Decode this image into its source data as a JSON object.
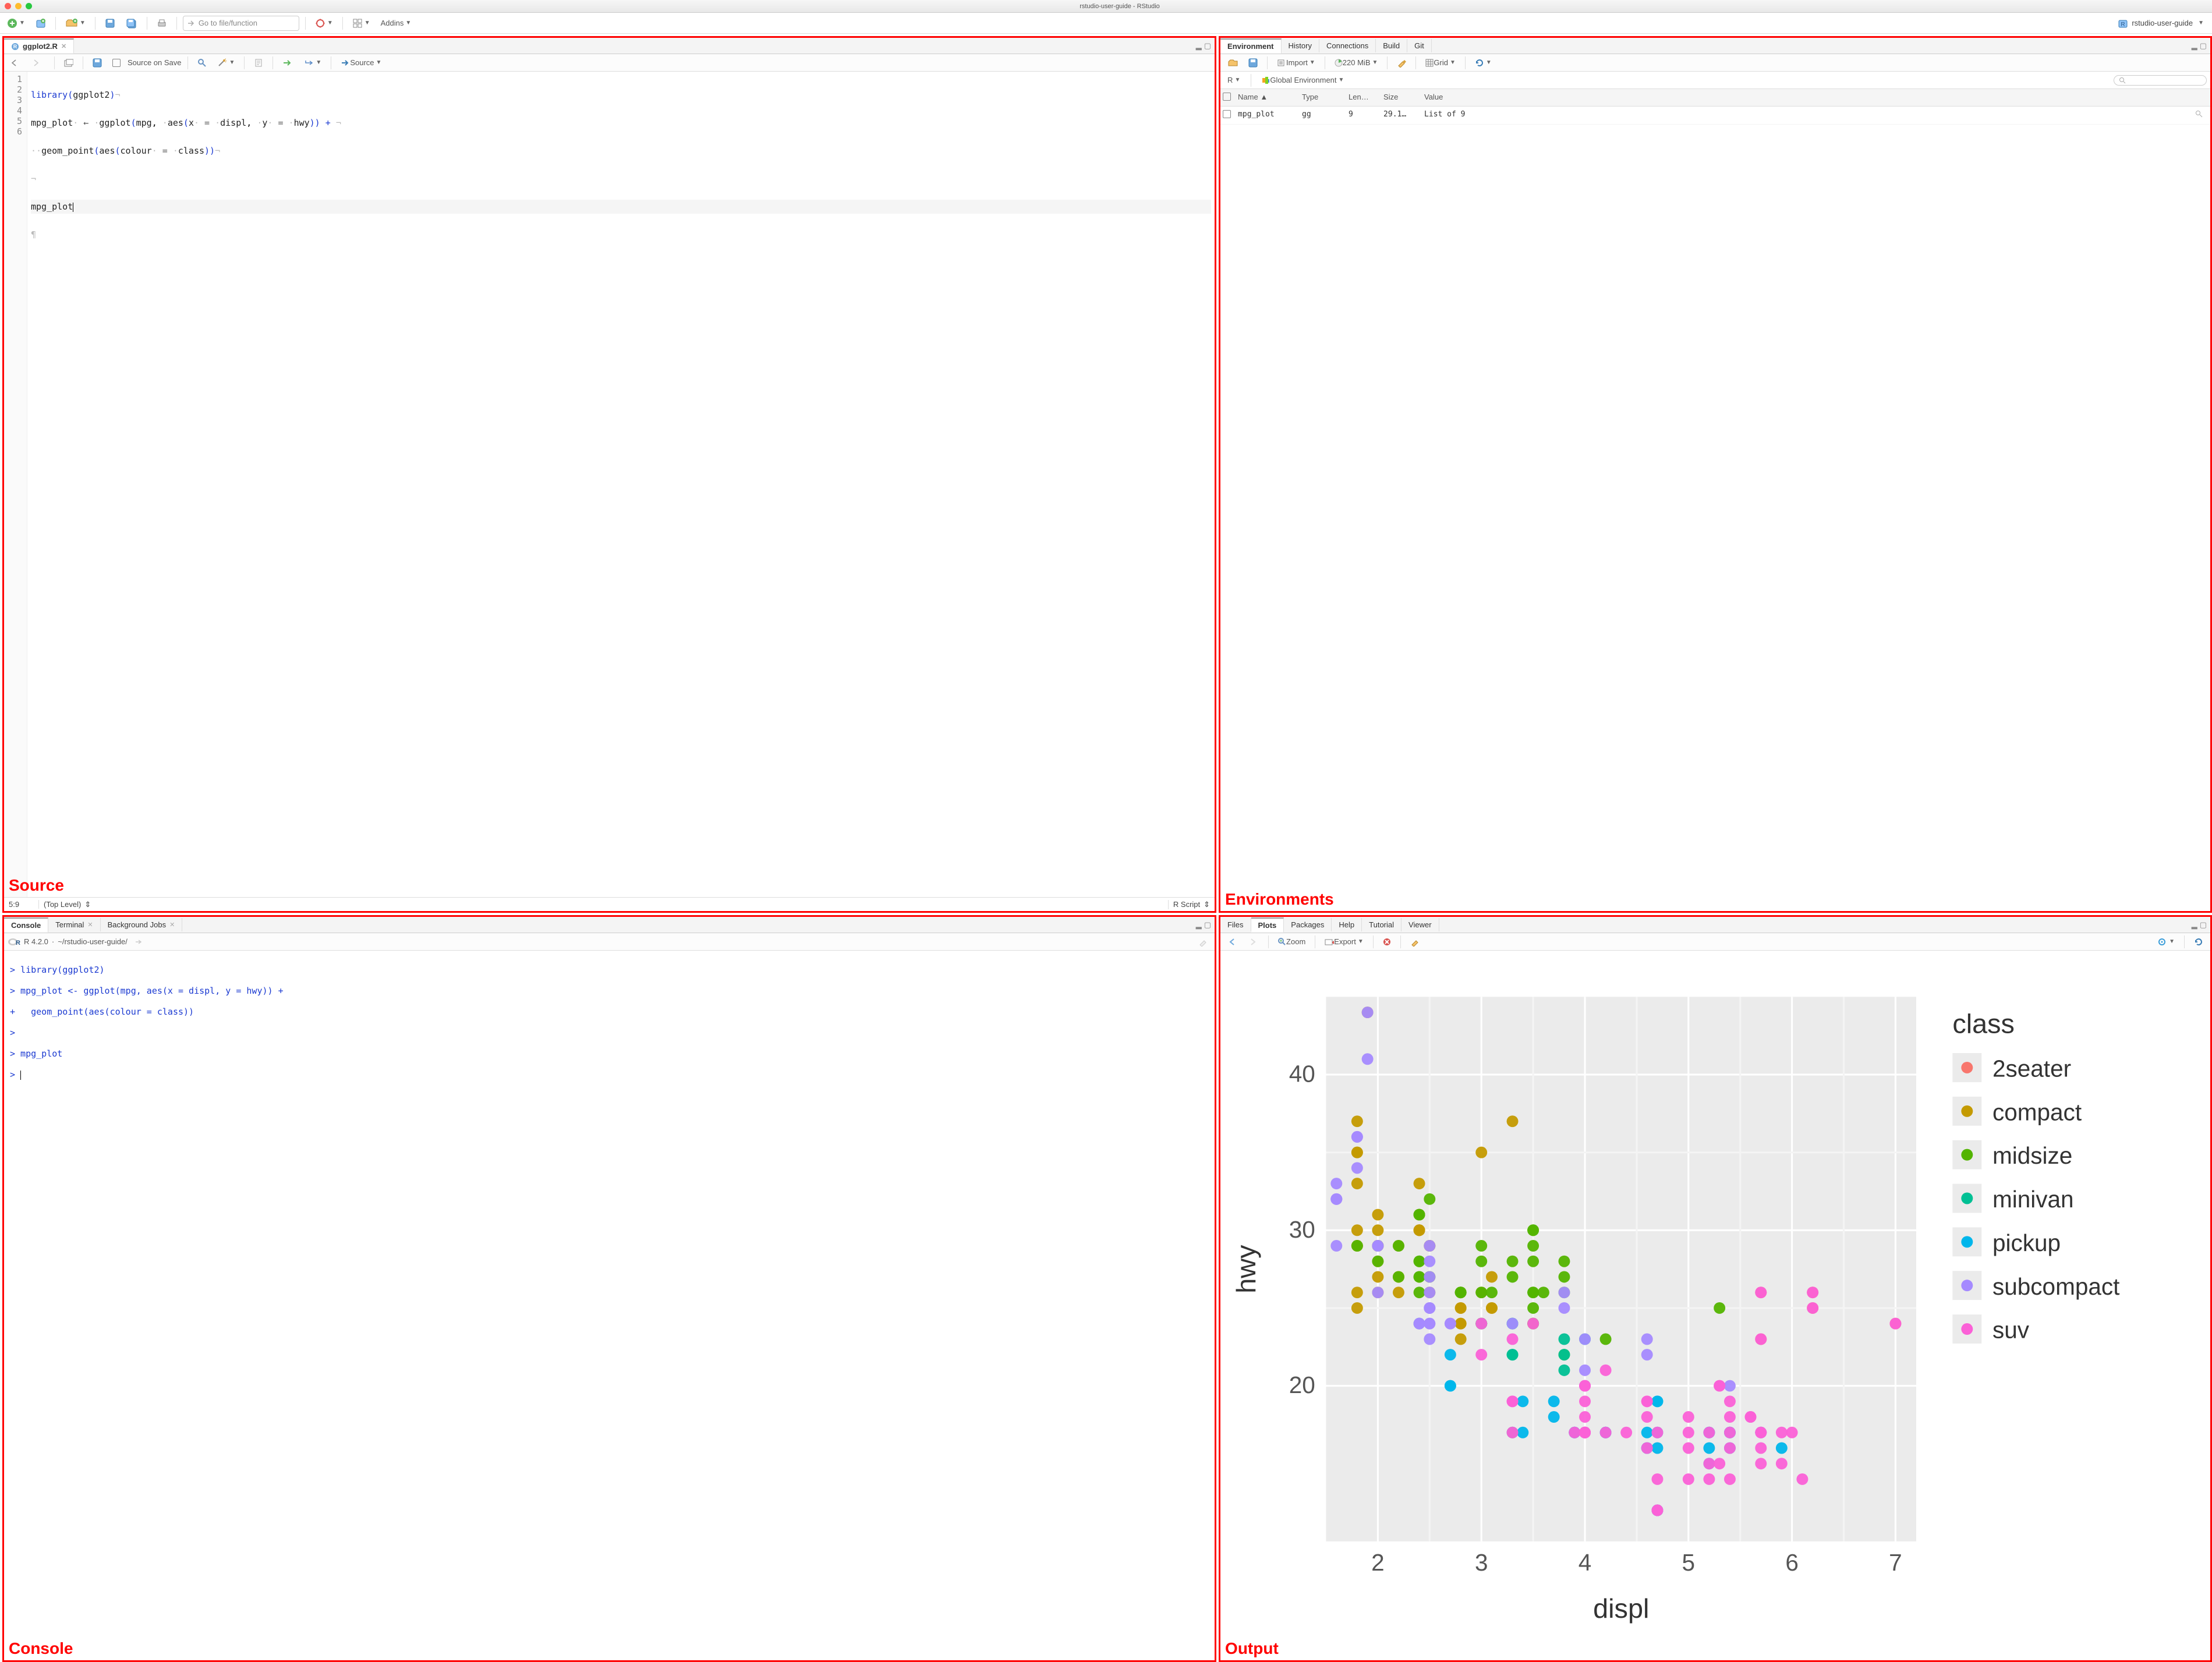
{
  "window": {
    "title": "rstudio-user-guide - RStudio"
  },
  "toolbar": {
    "goto_placeholder": "Go to file/function",
    "addins_label": "Addins",
    "project_label": "rstudio-user-guide"
  },
  "source": {
    "tab_label": "ggplot2.R",
    "source_on_save_label": "Source on Save",
    "source_btn": "Source",
    "line_numbers": [
      "1",
      "2",
      "3",
      "4",
      "5",
      "6"
    ],
    "code_lines": {
      "l1_a": "library",
      "l1_b": "(",
      "l1_c": "ggplot2",
      "l1_d": ")",
      "l2_a": "mpg_plot",
      "l2_b": " ← ",
      "l2_c": "ggplot",
      "l2_d": "(",
      "l2_e": "mpg",
      "l2_f": ", ",
      "l2_g": "aes",
      "l2_h": "(",
      "l2_i": "x",
      "l2_j": " = ",
      "l2_k": "displ",
      "l2_l": ", ",
      "l2_m": "y",
      "l2_n": " = ",
      "l2_o": "hwy",
      "l2_p": ")) + ",
      "l3_a": "  ",
      "l3_b": "geom_point",
      "l3_c": "(",
      "l3_d": "aes",
      "l3_e": "(",
      "l3_f": "colour",
      "l3_g": " = ",
      "l3_h": "class",
      "l3_i": "))",
      "l5_a": "mpg_plot"
    },
    "status_pos": "5:9",
    "status_scope": "(Top Level)",
    "status_type": "R Script",
    "label": "Source"
  },
  "env": {
    "tabs": [
      "Environment",
      "History",
      "Connections",
      "Build",
      "Git"
    ],
    "import_label": "Import",
    "memory": "220 MiB",
    "grid_label": "Grid",
    "scope_lang": "R",
    "scope_label": "Global Environment",
    "search_placeholder": "",
    "columns": [
      "Name",
      "Type",
      "Len…",
      "Size",
      "Value"
    ],
    "rows": [
      {
        "name": "mpg_plot",
        "type": "gg",
        "length": "9",
        "size": "29.1…",
        "value": "List of 9"
      }
    ],
    "label": "Environments"
  },
  "console": {
    "tabs": [
      "Console",
      "Terminal",
      "Background Jobs"
    ],
    "version": "R 4.2.0",
    "sep": " · ",
    "path": "~/rstudio-user-guide/",
    "lines": [
      "> library(ggplot2)",
      "> mpg_plot <- ggplot(mpg, aes(x = displ, y = hwy)) +",
      "+   geom_point(aes(colour = class))",
      "> ",
      "> mpg_plot",
      "> "
    ],
    "label": "Console"
  },
  "output": {
    "tabs": [
      "Files",
      "Plots",
      "Packages",
      "Help",
      "Tutorial",
      "Viewer"
    ],
    "zoom_label": "Zoom",
    "export_label": "Export",
    "label": "Output"
  },
  "chart_data": {
    "type": "scatter",
    "title": "",
    "xlabel": "displ",
    "ylabel": "hwy",
    "legend_title": "class",
    "xlim": [
      1.5,
      7.2
    ],
    "ylim": [
      10,
      45
    ],
    "xticks": [
      2,
      3,
      4,
      5,
      6,
      7
    ],
    "yticks": [
      20,
      30,
      40
    ],
    "series": [
      {
        "name": "2seater",
        "color": "#F8766D",
        "points": [
          [
            5.7,
            26
          ],
          [
            5.7,
            23
          ],
          [
            6.2,
            26
          ],
          [
            6.2,
            25
          ],
          [
            7.0,
            24
          ]
        ]
      },
      {
        "name": "compact",
        "color": "#C49A00",
        "points": [
          [
            1.8,
            29
          ],
          [
            1.8,
            29
          ],
          [
            2.0,
            31
          ],
          [
            2.0,
            30
          ],
          [
            2.8,
            26
          ],
          [
            2.8,
            26
          ],
          [
            3.1,
            27
          ],
          [
            1.8,
            26
          ],
          [
            1.8,
            25
          ],
          [
            2.0,
            28
          ],
          [
            2.0,
            27
          ],
          [
            2.8,
            25
          ],
          [
            2.8,
            25
          ],
          [
            3.1,
            25
          ],
          [
            3.1,
            25
          ],
          [
            2.4,
            30
          ],
          [
            2.4,
            30
          ],
          [
            2.5,
            26
          ],
          [
            2.5,
            27
          ],
          [
            2.2,
            27
          ],
          [
            2.2,
            29
          ],
          [
            2.4,
            31
          ],
          [
            2.4,
            31
          ],
          [
            3.0,
            26
          ],
          [
            2.2,
            26
          ],
          [
            2.2,
            27
          ],
          [
            2.4,
            30
          ],
          [
            2.4,
            33
          ],
          [
            3.0,
            35
          ],
          [
            3.3,
            37
          ],
          [
            1.8,
            30
          ],
          [
            1.8,
            33
          ],
          [
            1.8,
            35
          ],
          [
            1.8,
            37
          ],
          [
            1.8,
            35
          ],
          [
            2.0,
            29
          ],
          [
            2.0,
            26
          ],
          [
            2.0,
            29
          ],
          [
            2.0,
            29
          ],
          [
            2.8,
            24
          ],
          [
            1.9,
            44
          ],
          [
            2.0,
            29
          ],
          [
            2.0,
            29
          ],
          [
            2.5,
            29
          ],
          [
            2.5,
            29
          ],
          [
            2.8,
            23
          ],
          [
            2.8,
            24
          ]
        ]
      },
      {
        "name": "midsize",
        "color": "#53B400",
        "points": [
          [
            2.8,
            26
          ],
          [
            3.1,
            26
          ],
          [
            4.2,
            23
          ],
          [
            2.4,
            27
          ],
          [
            3.5,
            29
          ],
          [
            3.6,
            26
          ],
          [
            2.4,
            26
          ],
          [
            2.4,
            27
          ],
          [
            2.4,
            28
          ],
          [
            2.4,
            28
          ],
          [
            2.5,
            27
          ],
          [
            2.5,
            32
          ],
          [
            3.5,
            28
          ],
          [
            3.5,
            25
          ],
          [
            3.0,
            26
          ],
          [
            3.0,
            29
          ],
          [
            3.3,
            28
          ],
          [
            3.3,
            27
          ],
          [
            3.8,
            26
          ],
          [
            3.8,
            28
          ],
          [
            3.8,
            27
          ],
          [
            5.3,
            25
          ],
          [
            2.2,
            29
          ],
          [
            2.2,
            27
          ],
          [
            2.4,
            31
          ],
          [
            2.4,
            31
          ],
          [
            3.0,
            28
          ],
          [
            1.8,
            29
          ],
          [
            2.0,
            28
          ],
          [
            2.0,
            29
          ],
          [
            2.8,
            26
          ],
          [
            2.8,
            26
          ],
          [
            3.5,
            30
          ],
          [
            3.5,
            30
          ],
          [
            3.0,
            24
          ],
          [
            3.0,
            24
          ],
          [
            3.5,
            24
          ],
          [
            3.5,
            24
          ],
          [
            3.5,
            26
          ],
          [
            3.5,
            26
          ],
          [
            3.8,
            22
          ]
        ]
      },
      {
        "name": "minivan",
        "color": "#00C094",
        "points": [
          [
            2.4,
            24
          ],
          [
            3.0,
            24
          ],
          [
            3.3,
            22
          ],
          [
            3.3,
            22
          ],
          [
            3.3,
            24
          ],
          [
            3.3,
            24
          ],
          [
            3.3,
            17
          ],
          [
            3.8,
            22
          ],
          [
            3.8,
            21
          ],
          [
            3.8,
            23
          ],
          [
            4.0,
            23
          ]
        ]
      },
      {
        "name": "pickup",
        "color": "#00B6EB",
        "points": [
          [
            3.7,
            19
          ],
          [
            3.7,
            18
          ],
          [
            3.9,
            17
          ],
          [
            3.9,
            17
          ],
          [
            4.7,
            19
          ],
          [
            4.7,
            19
          ],
          [
            4.7,
            12
          ],
          [
            5.2,
            17
          ],
          [
            5.2,
            15
          ],
          [
            5.7,
            17
          ],
          [
            5.9,
            16
          ],
          [
            4.7,
            12
          ],
          [
            4.7,
            17
          ],
          [
            4.7,
            16
          ],
          [
            4.7,
            12
          ],
          [
            5.2,
            16
          ],
          [
            5.2,
            17
          ],
          [
            4.2,
            17
          ],
          [
            4.2,
            17
          ],
          [
            4.6,
            16
          ],
          [
            4.6,
            16
          ],
          [
            4.6,
            17
          ],
          [
            5.4,
            17
          ],
          [
            5.4,
            16
          ],
          [
            5.4,
            17
          ],
          [
            2.7,
            20
          ],
          [
            2.7,
            20
          ],
          [
            2.7,
            22
          ],
          [
            3.4,
            17
          ],
          [
            3.4,
            19
          ],
          [
            4.0,
            20
          ],
          [
            4.0,
            17
          ]
        ]
      },
      {
        "name": "subcompact",
        "color": "#A58AFF",
        "points": [
          [
            3.8,
            26
          ],
          [
            3.8,
            25
          ],
          [
            4.0,
            23
          ],
          [
            4.0,
            21
          ],
          [
            4.6,
            23
          ],
          [
            4.6,
            22
          ],
          [
            5.4,
            20
          ],
          [
            1.6,
            33
          ],
          [
            1.6,
            32
          ],
          [
            1.6,
            32
          ],
          [
            1.6,
            29
          ],
          [
            1.6,
            32
          ],
          [
            1.8,
            34
          ],
          [
            1.8,
            36
          ],
          [
            1.8,
            36
          ],
          [
            2.0,
            29
          ],
          [
            2.4,
            24
          ],
          [
            2.4,
            24
          ],
          [
            2.5,
            24
          ],
          [
            2.5,
            24
          ],
          [
            3.3,
            24
          ],
          [
            2.5,
            26
          ],
          [
            2.5,
            25
          ],
          [
            2.5,
            23
          ],
          [
            2.5,
            25
          ],
          [
            2.5,
            27
          ],
          [
            2.5,
            25
          ],
          [
            2.7,
            24
          ],
          [
            2.7,
            24
          ],
          [
            1.9,
            44
          ],
          [
            1.9,
            41
          ],
          [
            2.0,
            29
          ],
          [
            2.0,
            26
          ],
          [
            2.5,
            28
          ],
          [
            2.5,
            29
          ]
        ]
      },
      {
        "name": "suv",
        "color": "#FB61D7",
        "points": [
          [
            5.3,
            20
          ],
          [
            5.3,
            15
          ],
          [
            5.3,
            20
          ],
          [
            5.7,
            17
          ],
          [
            6.0,
            17
          ],
          [
            5.7,
            26
          ],
          [
            5.7,
            23
          ],
          [
            6.2,
            26
          ],
          [
            6.2,
            25
          ],
          [
            7.0,
            24
          ],
          [
            5.2,
            17
          ],
          [
            5.2,
            14
          ],
          [
            5.7,
            17
          ],
          [
            5.9,
            15
          ],
          [
            4.7,
            14
          ],
          [
            5.2,
            15
          ],
          [
            5.7,
            15
          ],
          [
            5.9,
            17
          ],
          [
            4.6,
            19
          ],
          [
            5.0,
            17
          ],
          [
            4.0,
            17
          ],
          [
            4.0,
            19
          ],
          [
            4.0,
            17
          ],
          [
            4.0,
            17
          ],
          [
            4.6,
            19
          ],
          [
            5.0,
            18
          ],
          [
            3.9,
            17
          ],
          [
            4.7,
            12
          ],
          [
            4.7,
            17
          ],
          [
            4.7,
            12
          ],
          [
            5.7,
            16
          ],
          [
            6.1,
            14
          ],
          [
            4.0,
            17
          ],
          [
            4.2,
            17
          ],
          [
            4.4,
            17
          ],
          [
            4.6,
            16
          ],
          [
            5.4,
            17
          ],
          [
            5.4,
            16
          ],
          [
            5.4,
            18
          ],
          [
            4.0,
            17
          ],
          [
            4.0,
            17
          ],
          [
            4.0,
            20
          ],
          [
            4.0,
            17
          ],
          [
            4.0,
            20
          ],
          [
            5.0,
            14
          ],
          [
            4.2,
            21
          ],
          [
            4.6,
            18
          ],
          [
            5.0,
            16
          ],
          [
            3.3,
            17
          ],
          [
            3.3,
            19
          ],
          [
            4.0,
            18
          ],
          [
            5.6,
            18
          ],
          [
            3.0,
            22
          ],
          [
            3.0,
            24
          ],
          [
            3.5,
            24
          ],
          [
            3.3,
            19
          ],
          [
            3.3,
            23
          ],
          [
            4.0,
            20
          ],
          [
            5.6,
            18
          ],
          [
            5.4,
            19
          ],
          [
            5.4,
            14
          ]
        ]
      }
    ]
  }
}
